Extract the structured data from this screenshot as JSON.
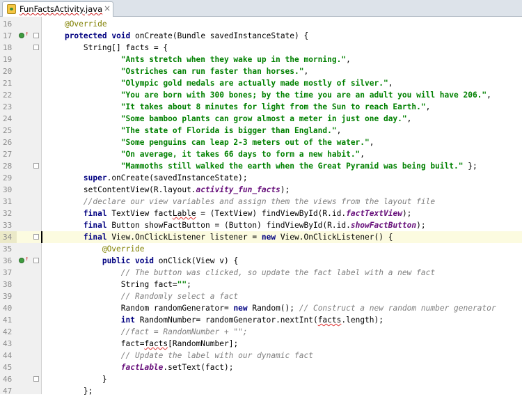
{
  "tab": {
    "title": "FunFactsActivity.java",
    "close_glyph": "×"
  },
  "icons": {
    "file": "java-class-file-icon",
    "close": "close-icon",
    "override": "override-method-icon",
    "fold": "fold-marker-icon"
  },
  "colors": {
    "keyword": "#000080",
    "string": "#008000",
    "annotation": "#808000",
    "comment": "#808080",
    "field": "#660e7a",
    "current_line": "#fcfbe0",
    "error_underline": "#e03030"
  },
  "lines": [
    {
      "n": "16",
      "indent": "    ",
      "tokens": [
        {
          "t": "@Override",
          "c": "ann"
        }
      ]
    },
    {
      "n": "17",
      "indent": "    ",
      "mark": true,
      "fold": true,
      "tokens": [
        {
          "t": "protected",
          "c": "kw"
        },
        {
          "t": " "
        },
        {
          "t": "void",
          "c": "kw"
        },
        {
          "t": " onCreate(Bundle savedInstanceState) {"
        }
      ]
    },
    {
      "n": "18",
      "indent": "        ",
      "fold": true,
      "tokens": [
        {
          "t": "String[] facts = {"
        }
      ]
    },
    {
      "n": "19",
      "indent": "                ",
      "tokens": [
        {
          "t": "\"Ants stretch when they wake up in the morning.\"",
          "c": "str"
        },
        {
          "t": ","
        }
      ]
    },
    {
      "n": "20",
      "indent": "                ",
      "tokens": [
        {
          "t": "\"Ostriches can run faster than horses.\"",
          "c": "str"
        },
        {
          "t": ","
        }
      ]
    },
    {
      "n": "21",
      "indent": "                ",
      "tokens": [
        {
          "t": "\"Olympic gold medals are actually made mostly of silver.\"",
          "c": "str"
        },
        {
          "t": ","
        }
      ]
    },
    {
      "n": "22",
      "indent": "                ",
      "tokens": [
        {
          "t": "\"You are born with 300 bones; by the time you are an adult you will have 206.\"",
          "c": "str"
        },
        {
          "t": ","
        }
      ]
    },
    {
      "n": "23",
      "indent": "                ",
      "tokens": [
        {
          "t": "\"It takes about 8 minutes for light from the Sun to reach Earth.\"",
          "c": "str"
        },
        {
          "t": ","
        }
      ]
    },
    {
      "n": "24",
      "indent": "                ",
      "tokens": [
        {
          "t": "\"Some bamboo plants can grow almost a meter in just one day.\"",
          "c": "str"
        },
        {
          "t": ","
        }
      ]
    },
    {
      "n": "25",
      "indent": "                ",
      "tokens": [
        {
          "t": "\"The state of Florida is bigger than England.\"",
          "c": "str"
        },
        {
          "t": ","
        }
      ]
    },
    {
      "n": "26",
      "indent": "                ",
      "tokens": [
        {
          "t": "\"Some penguins can leap 2-3 meters out of the water.\"",
          "c": "str"
        },
        {
          "t": ","
        }
      ]
    },
    {
      "n": "27",
      "indent": "                ",
      "tokens": [
        {
          "t": "\"On average, it takes 66 days to form a new habit.\"",
          "c": "str"
        },
        {
          "t": ","
        }
      ]
    },
    {
      "n": "28",
      "indent": "                ",
      "fold": true,
      "tokens": [
        {
          "t": "\"Mammoths still walked the earth when the Great Pyramid was being built.\"",
          "c": "str"
        },
        {
          "t": " };"
        }
      ]
    },
    {
      "n": "29",
      "indent": "        ",
      "tokens": [
        {
          "t": "super",
          "c": "kw"
        },
        {
          "t": ".onCreate(savedInstanceState);"
        }
      ]
    },
    {
      "n": "30",
      "indent": "        ",
      "tokens": [
        {
          "t": "setContentView(R.layout."
        },
        {
          "t": "activity_fun_facts",
          "c": "fld"
        },
        {
          "t": ");"
        }
      ]
    },
    {
      "n": "31",
      "indent": "        ",
      "tokens": [
        {
          "t": "//declare our view variables and assign them the views from the layout file",
          "c": "com"
        }
      ]
    },
    {
      "n": "32",
      "indent": "        ",
      "tokens": [
        {
          "t": "final",
          "c": "kw"
        },
        {
          "t": " TextView fact"
        },
        {
          "t": "Lable",
          "c": "err"
        },
        {
          "t": " = (TextView) findViewById(R.id."
        },
        {
          "t": "factTextView",
          "c": "fld"
        },
        {
          "t": ");"
        }
      ]
    },
    {
      "n": "33",
      "indent": "        ",
      "tokens": [
        {
          "t": "final",
          "c": "kw"
        },
        {
          "t": " Button showFactButton = (Button) findViewById(R.id."
        },
        {
          "t": "showFactButton",
          "c": "fld"
        },
        {
          "t": ");"
        }
      ]
    },
    {
      "n": "34",
      "indent": "        ",
      "current": true,
      "caret": true,
      "fold": true,
      "tokens": [
        {
          "t": "final",
          "c": "kw"
        },
        {
          "t": " View.OnClickListener listener = "
        },
        {
          "t": "new",
          "c": "kw"
        },
        {
          "t": " View.OnClickListener() {"
        }
      ]
    },
    {
      "n": "35",
      "indent": "            ",
      "tokens": [
        {
          "t": "@Override",
          "c": "ann"
        }
      ]
    },
    {
      "n": "36",
      "indent": "            ",
      "mark": true,
      "fold": true,
      "tokens": [
        {
          "t": "public",
          "c": "kw"
        },
        {
          "t": " "
        },
        {
          "t": "void",
          "c": "kw"
        },
        {
          "t": " onClick(View v) {"
        }
      ]
    },
    {
      "n": "37",
      "indent": "                ",
      "tokens": [
        {
          "t": "// The button was clicked, so update the fact label with a new fact",
          "c": "com"
        }
      ]
    },
    {
      "n": "38",
      "indent": "                ",
      "tokens": [
        {
          "t": "String fact="
        },
        {
          "t": "\"\"",
          "c": "str"
        },
        {
          "t": ";"
        }
      ]
    },
    {
      "n": "39",
      "indent": "                ",
      "tokens": [
        {
          "t": "// Randomly select a fact",
          "c": "com"
        }
      ]
    },
    {
      "n": "40",
      "indent": "                ",
      "tokens": [
        {
          "t": "Random randomGenerator= "
        },
        {
          "t": "new",
          "c": "kw"
        },
        {
          "t": " Random(); "
        },
        {
          "t": "// Construct a new random number generator",
          "c": "com"
        }
      ]
    },
    {
      "n": "41",
      "indent": "                ",
      "tokens": [
        {
          "t": "int",
          "c": "kw"
        },
        {
          "t": " RandomNumber= randomGenerator.nextInt("
        },
        {
          "t": "facts",
          "c": "err"
        },
        {
          "t": ".length);"
        }
      ]
    },
    {
      "n": "42",
      "indent": "                ",
      "tokens": [
        {
          "t": "//fact = RandomNumber + \"\";",
          "c": "com"
        }
      ]
    },
    {
      "n": "43",
      "indent": "                ",
      "tokens": [
        {
          "t": "fact="
        },
        {
          "t": "facts",
          "c": "err"
        },
        {
          "t": "[RandomNumber];"
        }
      ]
    },
    {
      "n": "44",
      "indent": "                ",
      "tokens": [
        {
          "t": "// Update the label with our dynamic fact",
          "c": "com"
        }
      ]
    },
    {
      "n": "45",
      "indent": "                ",
      "tokens": [
        {
          "t": "factLable",
          "c": "fld"
        },
        {
          "t": ".setText(fact);"
        }
      ]
    },
    {
      "n": "46",
      "indent": "            ",
      "fold": true,
      "tokens": [
        {
          "t": "}"
        }
      ]
    },
    {
      "n": "47",
      "indent": "        ",
      "tokens": [
        {
          "t": "};"
        }
      ]
    }
  ]
}
